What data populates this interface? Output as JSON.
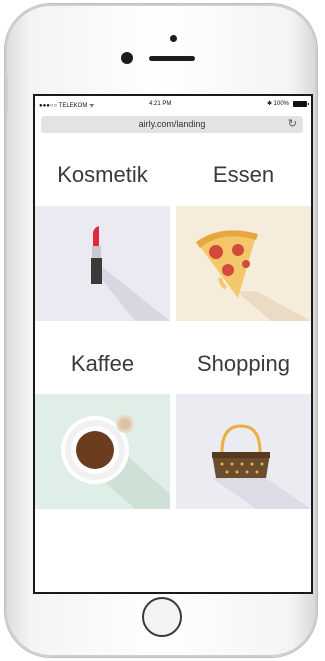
{
  "device": {
    "status_bar": {
      "carrier": "●●●○○ TELEKOM ᯤ",
      "time": "4:21 PM",
      "battery": "✱ 100%"
    },
    "browser": {
      "url": "airly.com/landing",
      "reload_icon": "reload-icon"
    }
  },
  "categories": [
    {
      "label": "Kosmetik",
      "icon": "lipstick-icon",
      "tile_color": "#ebe9f1"
    },
    {
      "label": "Essen",
      "icon": "pizza-slice-icon",
      "tile_color": "#f6ecdc"
    },
    {
      "label": "Kaffee",
      "icon": "coffee-cup-icon",
      "tile_color": "#dfeee6"
    },
    {
      "label": "Shopping",
      "icon": "handbag-icon",
      "tile_color": "#ebebf2"
    }
  ],
  "colors": {
    "lipstick": "#e02a3c",
    "lipstick_base": "#3a3a3a",
    "pizza_crust": "#f2b84b",
    "pepperoni": "#d24a3a",
    "coffee": "#6b3d1e",
    "bag": "#6b4c2e",
    "bag_handle": "#e7b240"
  }
}
